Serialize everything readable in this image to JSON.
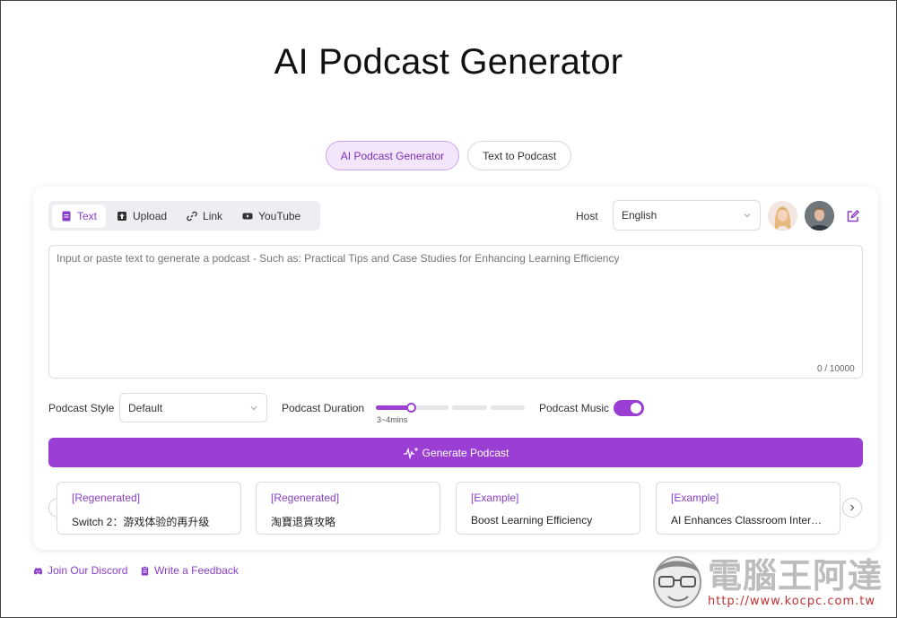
{
  "page": {
    "title": "AI Podcast Generator"
  },
  "mode_tabs": [
    {
      "label": "AI Podcast Generator",
      "active": true
    },
    {
      "label": "Text to Podcast",
      "active": false
    }
  ],
  "input_tabs": [
    {
      "label": "Text",
      "icon": "document-icon",
      "active": true
    },
    {
      "label": "Upload",
      "icon": "upload-icon",
      "active": false
    },
    {
      "label": "Link",
      "icon": "link-icon",
      "active": false
    },
    {
      "label": "YouTube",
      "icon": "youtube-icon",
      "active": false
    }
  ],
  "host": {
    "label": "Host",
    "language": "English"
  },
  "editor": {
    "placeholder": "Input or paste text to generate a podcast - Such as: Practical Tips and Case Studies for Enhancing Learning Efficiency",
    "counter": "0 / 10000"
  },
  "options": {
    "style_label": "Podcast Style",
    "style_value": "Default",
    "duration_label": "Podcast Duration",
    "duration_value": "3~4mins",
    "duration_step": 1,
    "duration_steps": 4,
    "music_label": "Podcast Music",
    "music_on": true
  },
  "generate": {
    "label": "Generate Podcast"
  },
  "examples": [
    {
      "tag": "[Regenerated]",
      "title": "Switch 2：游戏体验的再升级"
    },
    {
      "tag": "[Regenerated]",
      "title": "淘寶退貨攻略"
    },
    {
      "tag": "[Example]",
      "title": "Boost Learning Efficiency"
    },
    {
      "tag": "[Example]",
      "title": "AI Enhances Classroom Interaction"
    }
  ],
  "footer": {
    "discord": "Join Our Discord",
    "feedback": "Write a Feedback"
  },
  "watermark": {
    "text": "電腦王阿達",
    "url": "http://www.kocpc.com.tw"
  },
  "colors": {
    "accent": "#9b3fd4",
    "accent_text": "#8b3fc9",
    "accent_soft": "#f3e6fb"
  }
}
